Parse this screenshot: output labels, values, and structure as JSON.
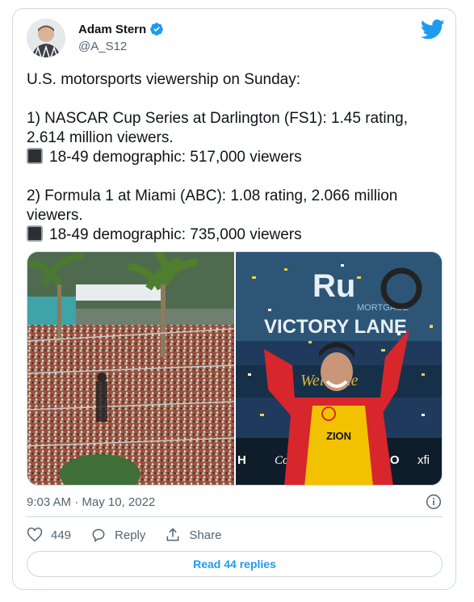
{
  "author": {
    "name": "Adam Stern",
    "handle": "@A_S12",
    "verified": true
  },
  "tweet": {
    "lines": [
      "U.S. motorsports viewership on Sunday:",
      "1) NASCAR Cup Series at Darlington (FS1): 1.45 rating,",
      "2.614 million viewers.",
      "18-49 demographic: 517,000 viewers",
      "2) Formula 1 at Miami (ABC): 1.08 rating, 2.066 million",
      "viewers.",
      "18-49 demographic: 735,000 viewers"
    ]
  },
  "media": {
    "left_photo_text": [],
    "right_photo_text": [
      "Ru",
      "MORTGAGE",
      "VICTORY LANE",
      "Welcome",
      "Coca-Cola",
      "xfi",
      "ZION",
      "CO",
      "H"
    ]
  },
  "timestamp": "9:03 AM · May 10, 2022",
  "actions": {
    "like_count": "449",
    "reply_label": "Reply",
    "share_label": "Share"
  },
  "read_replies_label": "Read 44 replies",
  "colors": {
    "accent": "#1d9bf0",
    "text": "#0f1419",
    "muted": "#536471",
    "border": "#cfd9de"
  },
  "icons": [
    "verified-badge-icon",
    "twitter-bird-icon",
    "info-icon",
    "heart-icon",
    "reply-bubble-icon",
    "share-icon",
    "black-square-emoji-icon"
  ]
}
